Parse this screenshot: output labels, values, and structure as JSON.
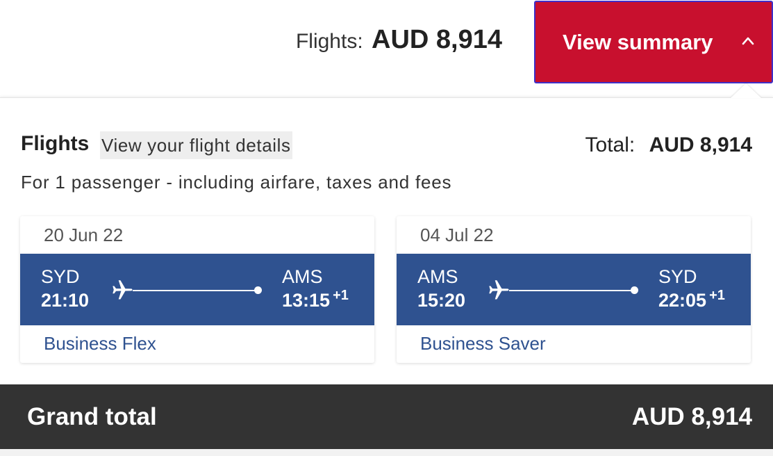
{
  "header": {
    "flights_label": "Flights:",
    "flights_amount": "AUD 8,914",
    "summary_button": "View summary",
    "summary_icon": "chevron-up-icon"
  },
  "summary": {
    "title": "Flights",
    "details_link": "View your flight details",
    "total_label": "Total:",
    "total_amount": "AUD 8,914",
    "passenger_info": "For 1 passenger - including airfare, taxes and fees"
  },
  "flights": [
    {
      "date": "20 Jun 22",
      "origin": "SYD",
      "depart_time": "21:10",
      "destination": "AMS",
      "arrive_time": "13:15",
      "day_offset": "+1",
      "cabin": "Business Flex"
    },
    {
      "date": "04 Jul 22",
      "origin": "AMS",
      "depart_time": "15:20",
      "destination": "SYD",
      "arrive_time": "22:05",
      "day_offset": "+1",
      "cabin": "Business Saver"
    }
  ],
  "grand_total": {
    "label": "Grand total",
    "amount": "AUD 8,914"
  },
  "colors": {
    "brand_red": "#c8102e",
    "flight_band_blue": "#2f5290",
    "grand_total_bg": "#333333"
  }
}
